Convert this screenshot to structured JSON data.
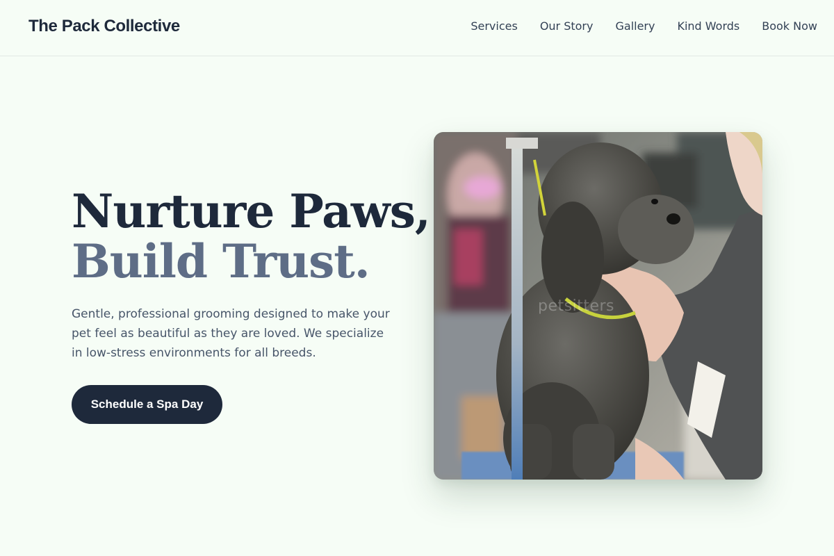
{
  "header": {
    "brand": "The Pack Collective",
    "nav": [
      "Services",
      "Our Story",
      "Gallery",
      "Kind Words",
      "Book Now"
    ]
  },
  "hero": {
    "headline_line1": "Nurture Paws,",
    "headline_line2": "Build Trust.",
    "description": "Gentle, professional grooming designed to make your pet feel as beautiful as they are loved. We specialize in low-stress environments for all breeds.",
    "cta_label": "Schedule a Spa Day",
    "image_watermark": "petsitters"
  },
  "colors": {
    "background": "#f6fdf6",
    "primary_dark": "#1e293b",
    "headline_muted": "#5e6d86",
    "body_text": "#475569"
  }
}
